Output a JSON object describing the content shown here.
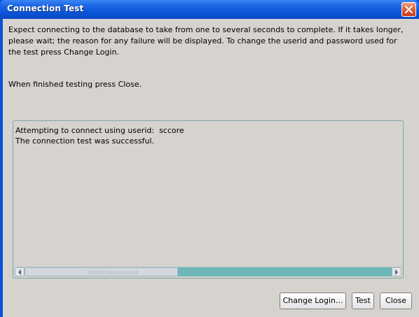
{
  "window": {
    "title": "Connection Test",
    "close_icon": "close-icon"
  },
  "message": {
    "paragraph1": "Expect connecting to the database to take from one to several seconds to complete. If it takes longer, please wait; the reason for any failure will be displayed. To change the userid and password used for the test press Change Login.",
    "paragraph2": "When finished testing press Close."
  },
  "log": {
    "lines": [
      "Attempting to connect using userid:  sccore",
      "The connection test was successful."
    ]
  },
  "buttons": {
    "change_login": "Change Login...",
    "test": "Test",
    "close": "Close"
  },
  "colors": {
    "titlebar": "#0b55d8",
    "client_bg": "#d6d3ce",
    "scroll_track": "#6fb6b9"
  }
}
